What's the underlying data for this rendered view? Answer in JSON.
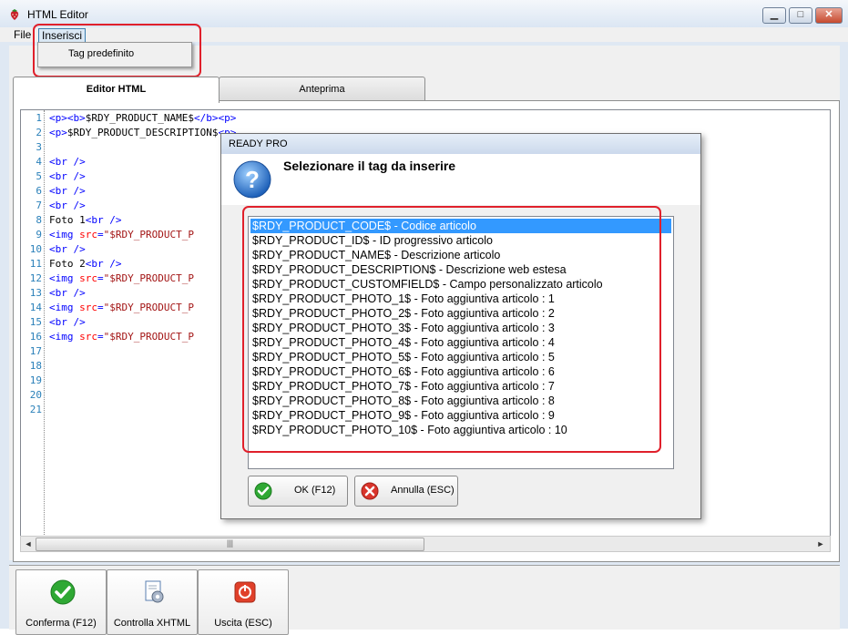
{
  "window": {
    "title": "HTML Editor",
    "controls": {
      "minimize": "▁",
      "maximize": "□",
      "close": "✕"
    }
  },
  "menu": {
    "file": "File",
    "insert": "Inserisci",
    "insert_items": [
      "Tag predefinito"
    ]
  },
  "tabs": {
    "editor": "Editor HTML",
    "preview": "Anteprima"
  },
  "editor": {
    "line_numbers": [
      "1",
      "2",
      "3",
      "4",
      "5",
      "6",
      "7",
      "8",
      "9",
      "10",
      "11",
      "12",
      "13",
      "14",
      "15",
      "16",
      "17",
      "18",
      "19",
      "20",
      "21"
    ],
    "lines": [
      "<p><b>$RDY_PRODUCT_NAME$</b><p>",
      "<p>$RDY_PRODUCT_DESCRIPTION$<p>",
      "",
      "<br />",
      "<br />",
      "<br />",
      "<br />",
      "Foto 1<br />",
      "<img src=\"$RDY_PRODUCT_P",
      "<br />",
      "Foto 2<br />",
      "<img src=\"$RDY_PRODUCT_P",
      "<br />",
      "<img src=\"$RDY_PRODUCT_P",
      "<br />",
      "<img src=\"$RDY_PRODUCT_P",
      "",
      "",
      "",
      "",
      ""
    ],
    "scroll_grip": "|||",
    "scroll_left": "◄",
    "scroll_right": "►"
  },
  "bottom_buttons": [
    {
      "label": "Conferma (F12)",
      "icon": "green-check-icon"
    },
    {
      "label": "Controlla XHTML",
      "icon": "gear-document-icon"
    },
    {
      "label": "Uscita (ESC)",
      "icon": "red-exit-icon"
    }
  ],
  "dialog": {
    "title": "READY PRO",
    "heading": "Selezionare il tag da inserire",
    "items": [
      "$RDY_PRODUCT_CODE$ - Codice articolo",
      "$RDY_PRODUCT_ID$ - ID progressivo articolo",
      "$RDY_PRODUCT_NAME$ - Descrizione articolo",
      "$RDY_PRODUCT_DESCRIPTION$ - Descrizione web estesa",
      "$RDY_PRODUCT_CUSTOMFIELD$ - Campo personalizzato articolo",
      "$RDY_PRODUCT_PHOTO_1$ - Foto aggiuntiva articolo : 1",
      "$RDY_PRODUCT_PHOTO_2$ - Foto aggiuntiva articolo : 2",
      "$RDY_PRODUCT_PHOTO_3$ - Foto aggiuntiva articolo : 3",
      "$RDY_PRODUCT_PHOTO_4$ - Foto aggiuntiva articolo : 4",
      "$RDY_PRODUCT_PHOTO_5$ - Foto aggiuntiva articolo : 5",
      "$RDY_PRODUCT_PHOTO_6$ - Foto aggiuntiva articolo : 6",
      "$RDY_PRODUCT_PHOTO_7$ - Foto aggiuntiva articolo : 7",
      "$RDY_PRODUCT_PHOTO_8$ - Foto aggiuntiva articolo : 8",
      "$RDY_PRODUCT_PHOTO_9$ - Foto aggiuntiva articolo : 9",
      "$RDY_PRODUCT_PHOTO_10$ - Foto aggiuntiva articolo : 10"
    ],
    "selected_index": 0,
    "ok_label": "OK (F12)",
    "cancel_label": "Annulla (ESC)"
  },
  "colors": {
    "annotation": "#e0202b",
    "selection": "#3399ff",
    "line_number": "#2a80b9",
    "tag": "#0000ff",
    "attribute": "#ff0000",
    "string": "#a31515"
  }
}
